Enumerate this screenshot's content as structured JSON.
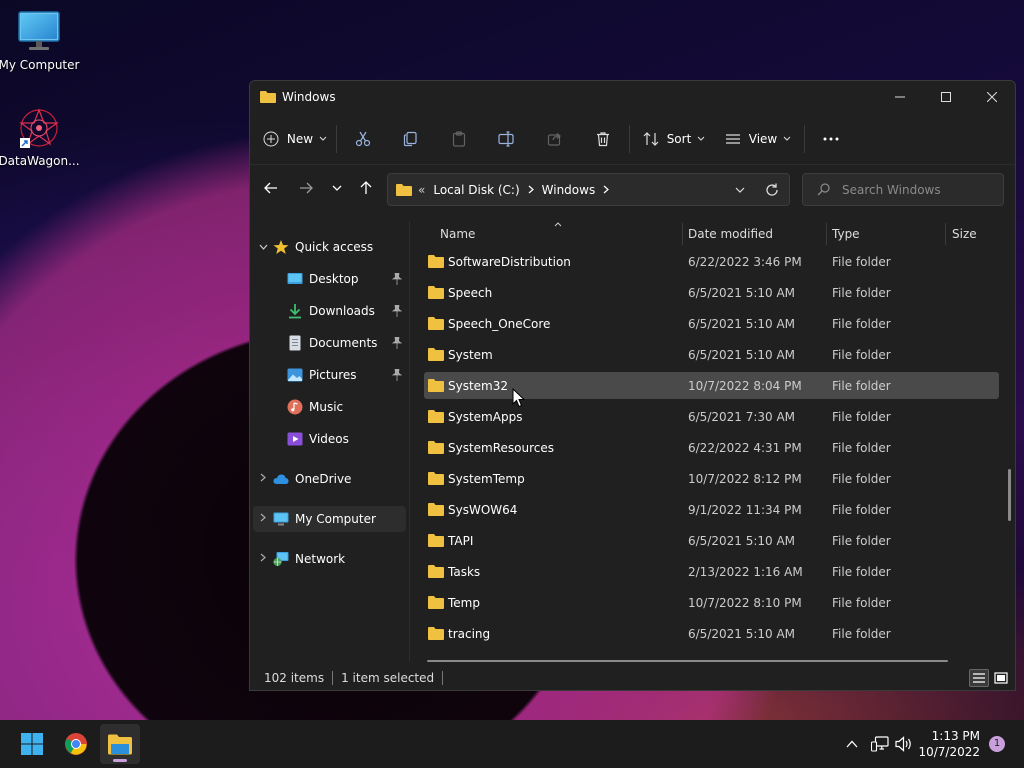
{
  "desktop": {
    "icons": [
      {
        "label": "My Computer",
        "icon": "monitor-icon"
      },
      {
        "label": "DataWagon...",
        "icon": "datawagon-shortcut-icon"
      }
    ]
  },
  "window": {
    "title": "Windows",
    "controls": {
      "minimize": "minimize",
      "maximize": "maximize",
      "close": "close"
    }
  },
  "toolbar": {
    "new_label": "New",
    "sort_label": "Sort",
    "view_label": "View",
    "more_label": "..."
  },
  "address": {
    "overflow": "«",
    "segments": [
      "Local Disk (C:)",
      "Windows"
    ]
  },
  "search": {
    "placeholder": "Search Windows"
  },
  "navpane": {
    "quick_access": "Quick access",
    "items": [
      {
        "label": "Desktop",
        "icon": "desktop-icon",
        "pinned": true
      },
      {
        "label": "Downloads",
        "icon": "download-icon",
        "pinned": true
      },
      {
        "label": "Documents",
        "icon": "document-icon",
        "pinned": true
      },
      {
        "label": "Pictures",
        "icon": "picture-icon",
        "pinned": true
      },
      {
        "label": "Music",
        "icon": "music-icon",
        "pinned": false
      },
      {
        "label": "Videos",
        "icon": "video-icon",
        "pinned": false
      }
    ],
    "onedrive": "OneDrive",
    "my_computer": "My Computer",
    "network": "Network"
  },
  "columns": {
    "name": "Name",
    "date": "Date modified",
    "type": "Type",
    "size": "Size"
  },
  "files": [
    {
      "name": "SoftwareDistribution",
      "date": "6/22/2022 3:46 PM",
      "type": "File folder"
    },
    {
      "name": "Speech",
      "date": "6/5/2021 5:10 AM",
      "type": "File folder"
    },
    {
      "name": "Speech_OneCore",
      "date": "6/5/2021 5:10 AM",
      "type": "File folder"
    },
    {
      "name": "System",
      "date": "6/5/2021 5:10 AM",
      "type": "File folder"
    },
    {
      "name": "System32",
      "date": "10/7/2022 8:04 PM",
      "type": "File folder",
      "selected": true
    },
    {
      "name": "SystemApps",
      "date": "6/5/2021 7:30 AM",
      "type": "File folder"
    },
    {
      "name": "SystemResources",
      "date": "6/22/2022 4:31 PM",
      "type": "File folder"
    },
    {
      "name": "SystemTemp",
      "date": "10/7/2022 8:12 PM",
      "type": "File folder"
    },
    {
      "name": "SysWOW64",
      "date": "9/1/2022 11:34 PM",
      "type": "File folder"
    },
    {
      "name": "TAPI",
      "date": "6/5/2021 5:10 AM",
      "type": "File folder"
    },
    {
      "name": "Tasks",
      "date": "2/13/2022 1:16 AM",
      "type": "File folder"
    },
    {
      "name": "Temp",
      "date": "10/7/2022 8:10 PM",
      "type": "File folder"
    },
    {
      "name": "tracing",
      "date": "6/5/2021 5:10 AM",
      "type": "File folder"
    }
  ],
  "status": {
    "item_count": "102 items",
    "selection": "1 item selected"
  },
  "taskbar": {
    "apps": [
      "start-icon",
      "chrome-icon",
      "file-explorer-icon"
    ],
    "clock_time": "1:13 PM",
    "clock_date": "10/7/2022",
    "notification_count": "1"
  },
  "colors": {
    "folder": "#f0c040",
    "accent": "#c9a0dc",
    "selected_row": "#4a4a4a",
    "window_bg": "#202020"
  }
}
